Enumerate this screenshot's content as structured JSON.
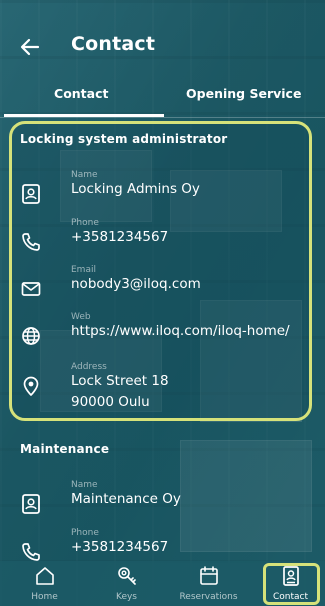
{
  "header": {
    "title": "Contact"
  },
  "tabs": [
    {
      "label": "Contact",
      "active": true
    },
    {
      "label": "Opening Service",
      "active": false
    }
  ],
  "locking_admin": {
    "section_title": "Locking system administrator",
    "name_label": "Name",
    "name_value": "Locking Admins Oy",
    "phone_label": "Phone",
    "phone_value": "+3581234567",
    "email_label": "Email",
    "email_value": "nobody3@iloq.com",
    "web_label": "Web",
    "web_value": "https://www.iloq.com/iloq-home/",
    "address_label": "Address",
    "address_line1": "Lock Street 18",
    "address_line2": "90000 Oulu"
  },
  "maintenance": {
    "section_title": "Maintenance",
    "name_label": "Name",
    "name_value": "Maintenance Oy",
    "phone_label": "Phone",
    "phone_value": "+3581234567"
  },
  "bottom_nav": [
    {
      "label": "Home",
      "icon": "home-icon",
      "active": false
    },
    {
      "label": "Keys",
      "icon": "keys-icon",
      "active": false
    },
    {
      "label": "Reservations",
      "icon": "calendar-icon",
      "active": false
    },
    {
      "label": "Contact",
      "icon": "contact-card-icon",
      "active": true
    }
  ],
  "colors": {
    "highlight": "#d6e27a",
    "background": "#1f6470",
    "text": "#ffffff"
  }
}
